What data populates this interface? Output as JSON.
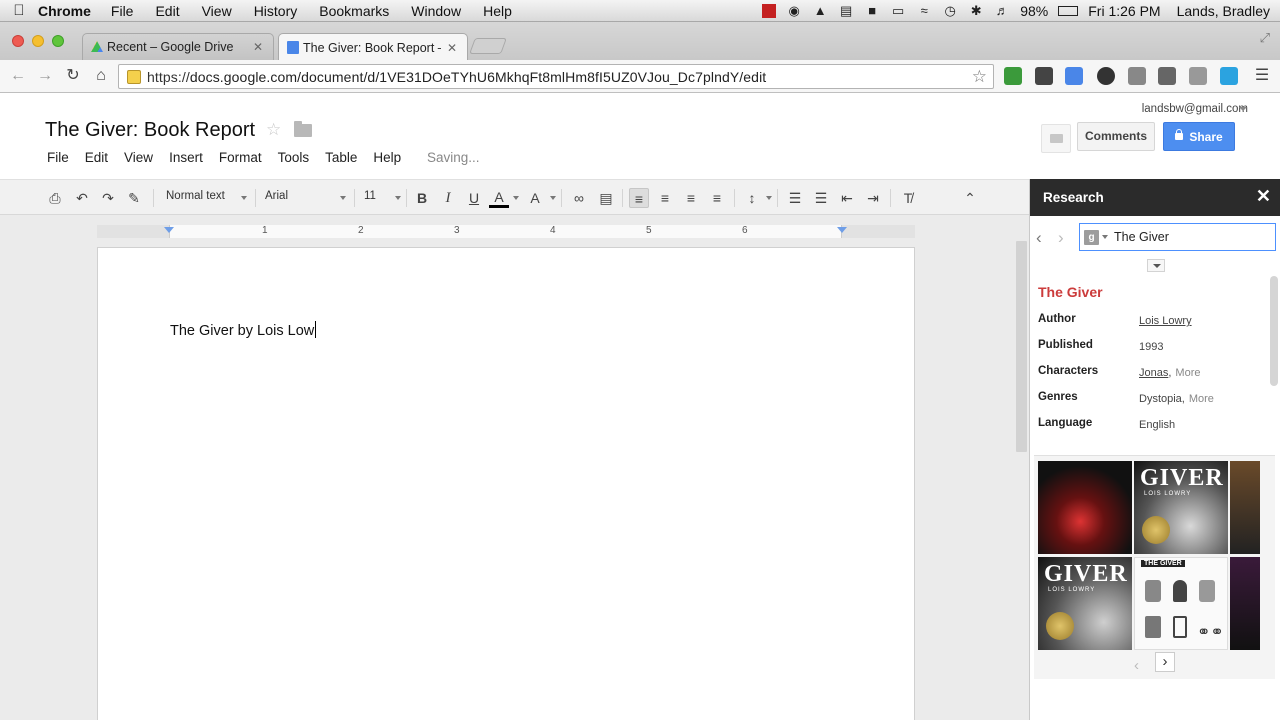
{
  "menubar": {
    "app": "Chrome",
    "items": [
      "File",
      "Edit",
      "View",
      "History",
      "Bookmarks",
      "Window",
      "Help"
    ],
    "battery": "98%",
    "clock": "Fri 1:26 PM",
    "user": "Lands, Bradley"
  },
  "tabs": [
    {
      "title": "Recent – Google Drive",
      "favicon": "drive-icon"
    },
    {
      "title": "The Giver: Book Report – G",
      "favicon": "docs-icon"
    }
  ],
  "omnibox": {
    "url_proto": "https://",
    "url_rest": "docs.google.com/document/d/1VE31DOeTYhU6MkhqFt8mlHm8fI5UZ0VJou_Dc7plndY/edit"
  },
  "doc": {
    "title": "The Giver: Book Report",
    "menu": [
      "File",
      "Edit",
      "View",
      "Insert",
      "Format",
      "Tools",
      "Table",
      "Help"
    ],
    "status": "Saving...",
    "account": "landsbw@gmail.com",
    "comments_label": "Comments",
    "share_label": "Share",
    "body_text": "The Giver by Lois Low"
  },
  "format_toolbar": {
    "style": "Normal text",
    "font": "Arial",
    "size": "11",
    "bold": "B",
    "italic": "I",
    "underline": "U",
    "text_color": "A",
    "highlight": "A"
  },
  "ruler": {
    "numbers": [
      "1",
      "2",
      "3",
      "4",
      "5",
      "6"
    ]
  },
  "research": {
    "title": "Research",
    "query": "The Giver",
    "kp_title": "The Giver",
    "rows": [
      {
        "label": "Author",
        "value": "Lois Lowry",
        "link": true,
        "more": ""
      },
      {
        "label": "Published",
        "value": "1993",
        "link": false,
        "more": ""
      },
      {
        "label": "Characters",
        "value": "Jonas",
        "link": true,
        "more": "More"
      },
      {
        "label": "Genres",
        "value": "Dystopia",
        "link": false,
        "more": "More"
      },
      {
        "label": "Language",
        "value": "English",
        "link": false,
        "more": ""
      }
    ],
    "thumbs": [
      {
        "title": "",
        "sub": ""
      },
      {
        "title": "GIVER",
        "sub": "LOIS LOWRY",
        "prefix": "The"
      },
      {
        "title": "GIVER",
        "sub": "LOIS LOWRY",
        "prefix": "The"
      },
      {
        "title": "",
        "sub": "THE GIVER"
      }
    ]
  },
  "colors": {
    "share_blue": "#4d8ef0",
    "kp_title_red": "#cc3c3c",
    "research_header": "#2b2b2b"
  }
}
